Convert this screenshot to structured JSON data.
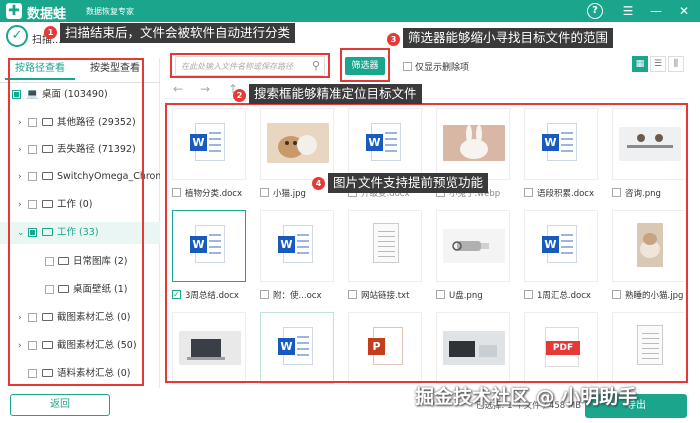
{
  "app": {
    "name": "数据蛙",
    "subtitle": "数据恢复专家",
    "logo_glyph": "✚"
  },
  "titlebar": {
    "help_icon": "?",
    "menu_icon": "☰",
    "minimize_icon": "—",
    "close_icon": "✕"
  },
  "status": {
    "text": "扫描结束后，文件会被软件自动进行分类"
  },
  "annotations": [
    {
      "num": "1",
      "text": "扫描结束后，文件会被软件自动进行分类"
    },
    {
      "num": "2",
      "text": "搜索框能够精准定位目标文件"
    },
    {
      "num": "3",
      "text": "筛选器能够缩小寻找目标文件的范围"
    },
    {
      "num": "4",
      "text": "图片文件支持提前预览功能"
    }
  ],
  "left_tabs": [
    "按路径查看",
    "按类型查看"
  ],
  "tree": [
    {
      "label": "桌面 (103490)"
    },
    {
      "label": "其他路径 (29352)"
    },
    {
      "label": "丢失路径 (71392)"
    },
    {
      "label": "SwitchyOmega_Chromium"
    },
    {
      "label": "工作 (0)"
    },
    {
      "label": "工作 (33)"
    },
    {
      "label": "日常图库 (2)"
    },
    {
      "label": "桌面壁纸 (1)"
    },
    {
      "label": "截图素材汇总 (0)"
    },
    {
      "label": "截图素材汇总 (50)"
    },
    {
      "label": "语料素材汇总 (0)"
    }
  ],
  "back_label": "返回",
  "search": {
    "placeholder": "在此处输入文件名称或保存路径"
  },
  "filter_label": "筛选器",
  "show_deleted_label": "仅显示删除项",
  "view_modes": [
    "▦",
    "☰",
    "⫼"
  ],
  "nav": {
    "back": "←",
    "forward": "→",
    "up": "↑"
  },
  "files_row1": [
    "植物分类.docx",
    "小猫.jpg",
    "",
    "",
    "语段积累.docx",
    "咨询.png"
  ],
  "files_row1_partial": [
    "升级变.docx",
    "小兔子.webp"
  ],
  "files_row2": [
    "3周总结.docx",
    "附：使...ocx",
    "网站链接.txt",
    "U盘.png",
    "1周汇总.docx",
    "熟睡的小猫.jpg"
  ],
  "pdf_label": "PDF",
  "bottom_status": "已选择: 1 个文件 / 458 MB",
  "restore_label": "导出",
  "watermark": "掘金技术社区 @ 小明助手"
}
